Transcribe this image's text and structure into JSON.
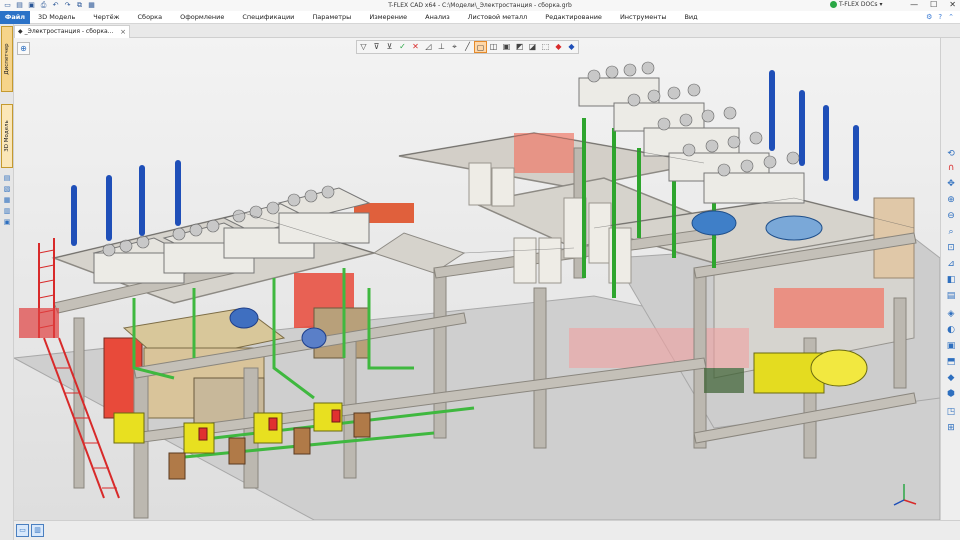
{
  "titlebar": {
    "title": "T-FLEX CAD x64 - C:\\Модели\\_Электростанция - сборка.grb",
    "docs_label": "T-FLEX DOCs",
    "quick_access": [
      "page-icon",
      "open-icon",
      "save-icon",
      "print-icon",
      "undo-icon",
      "redo-icon",
      "copy-icon",
      "paste-icon"
    ],
    "minimize": "—",
    "maximize": "☐",
    "close": "✕"
  },
  "ribbon": {
    "file_label": "Файл",
    "menu": [
      "3D Модель",
      "Чертёж",
      "Сборка",
      "Оформление",
      "Спецификации",
      "Параметры",
      "Измерение",
      "Анализ",
      "Листовой металл",
      "Редактирование",
      "Инструменты",
      "Вид"
    ],
    "right_icons": [
      "settings-icon",
      "help-icon",
      "restore-icon"
    ]
  },
  "tabs": [
    {
      "label": "_Электростанция - сборка...",
      "close": "×"
    }
  ],
  "sidebar": {
    "tabs": [
      {
        "label": "Диспетчер"
      },
      {
        "label": "3D Модель"
      }
    ]
  },
  "viewport": {
    "toolbar": [
      "filter-icon",
      "filter-plus-icon",
      "filter-minus-icon",
      "check-icon",
      "x-icon",
      "face-icon",
      "axis-icon",
      "snap-icon",
      "edge-icon",
      "box-icon",
      "cube-icon",
      "cube-outline-icon",
      "cube-face-icon",
      "cube-edge-icon",
      "cube-center-icon",
      "cube-red-icon",
      "cube-blue-icon"
    ],
    "toolbar_active_index": 9
  },
  "colors": {
    "accent": "#2b72c7",
    "tab_yellow": "#f6d48a",
    "frame_gray": "#b9b5ad",
    "pipe_green": "#44c044",
    "exhaust_blue": "#1f4fb8",
    "generator_yellow": "#e8e020",
    "panel_red": "#e84a3a"
  }
}
